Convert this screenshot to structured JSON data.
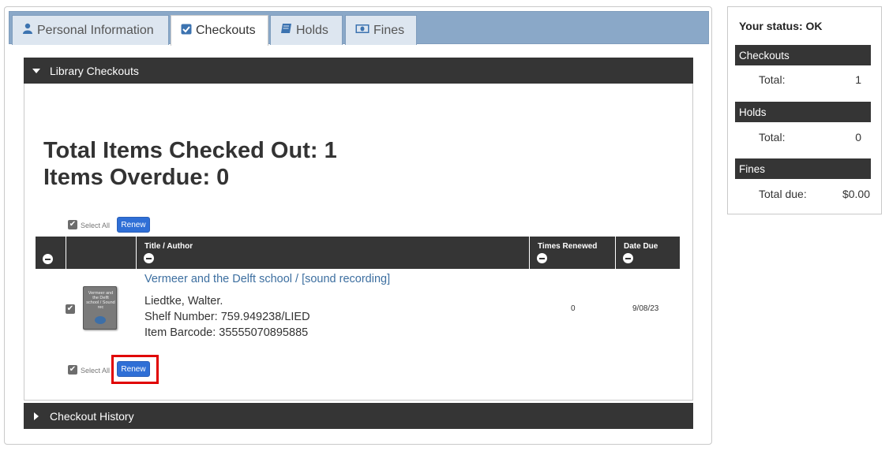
{
  "tabs": [
    {
      "label": "Personal Information",
      "icon": "user-icon",
      "active": false
    },
    {
      "label": "Checkouts",
      "icon": "checkbox-icon",
      "active": true
    },
    {
      "label": "Holds",
      "icon": "book-icon",
      "active": false
    },
    {
      "label": "Fines",
      "icon": "money-icon",
      "active": false
    }
  ],
  "checkouts_section": {
    "header": "Library Checkouts",
    "total_checked_out": "Total Items Checked Out: 1",
    "items_overdue": "Items Overdue: 0",
    "select_all_label": "Select All",
    "renew_label": "Renew",
    "columns": {
      "title_author": "Title / Author",
      "times_renewed": "Times Renewed",
      "date_due": "Date Due"
    },
    "items": [
      {
        "cover_text": "Vermeer and the Delft school / Sound rec",
        "title": "Vermeer and the Delft school / [sound recording]",
        "author": "Liedtke, Walter.",
        "shelf_number": "Shelf Number: 759.949238/LIED",
        "item_barcode": "Item Barcode: 35555070895885",
        "times_renewed": "0",
        "date_due": "9/08/23"
      }
    ]
  },
  "history_section": {
    "header": "Checkout History"
  },
  "sidebar": {
    "status": "Your status: OK",
    "checkouts": {
      "header": "Checkouts",
      "label": "Total:",
      "value": "1"
    },
    "holds": {
      "header": "Holds",
      "label": "Total:",
      "value": "0"
    },
    "fines": {
      "header": "Fines",
      "label": "Total due:",
      "value": "$0.00"
    }
  },
  "colors": {
    "tabbar": "#8aa8c8",
    "dark_header": "#353535",
    "renew_button": "#2f6fd6",
    "link": "#3d6fa0",
    "highlight": "#e00000"
  }
}
